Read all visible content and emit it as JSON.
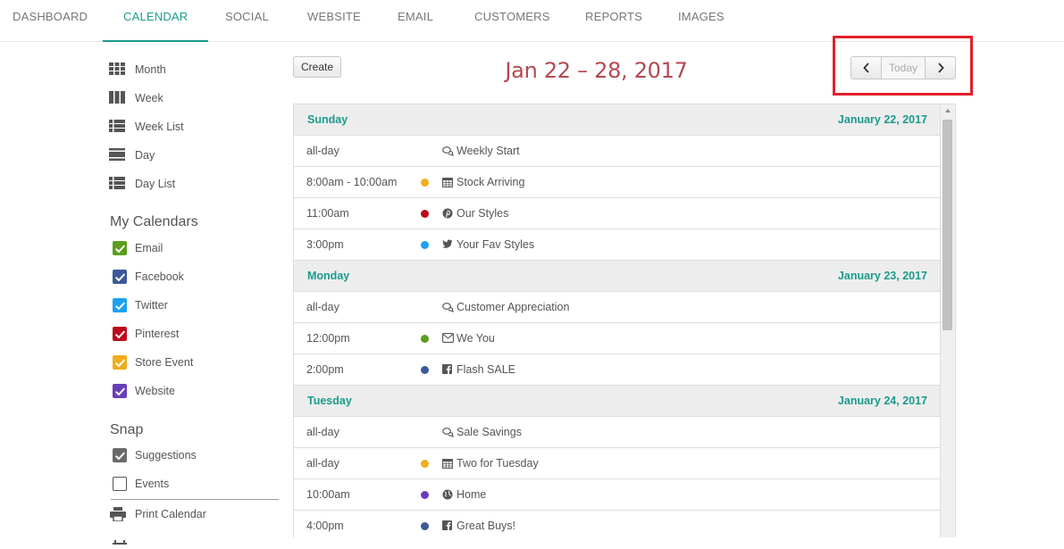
{
  "nav": {
    "tabs": [
      {
        "label": "DASHBOARD"
      },
      {
        "label": "CALENDAR"
      },
      {
        "label": "SOCIAL"
      },
      {
        "label": "WEBSITE"
      },
      {
        "label": "EMAIL"
      },
      {
        "label": "CUSTOMERS"
      },
      {
        "label": "REPORTS"
      },
      {
        "label": "IMAGES"
      }
    ],
    "active": "CALENDAR"
  },
  "sidebar": {
    "views": [
      {
        "label": "Month",
        "icon": "month-grid-icon"
      },
      {
        "label": "Week",
        "icon": "week-columns-icon"
      },
      {
        "label": "Week List",
        "icon": "week-list-icon"
      },
      {
        "label": "Day",
        "icon": "day-icon"
      },
      {
        "label": "Day List",
        "icon": "day-list-icon"
      }
    ],
    "my_calendars_title": "My Calendars",
    "calendars": [
      {
        "label": "Email",
        "color": "#5a9e1e",
        "checked": true
      },
      {
        "label": "Facebook",
        "color": "#3b5998",
        "checked": true
      },
      {
        "label": "Twitter",
        "color": "#1da1f2",
        "checked": true
      },
      {
        "label": "Pinterest",
        "color": "#bd081c",
        "checked": true
      },
      {
        "label": "Store Event",
        "color": "#f0ad1c",
        "checked": true
      },
      {
        "label": "Website",
        "color": "#6a3db8",
        "checked": true
      }
    ],
    "snap_title": "Snap",
    "snap": [
      {
        "label": "Suggestions",
        "checked": true,
        "color": "#6a6a6a"
      },
      {
        "label": "Events",
        "checked": false
      }
    ],
    "print_label": "Print Calendar"
  },
  "header": {
    "create_label": "Create",
    "range_title": "Jan 22 – 28, 2017",
    "today_label": "Today"
  },
  "agenda": [
    {
      "day": "Sunday",
      "date": "January 22, 2017",
      "events": [
        {
          "time": "all-day",
          "dot": null,
          "icon": "chat-icon",
          "title": "Weekly Start"
        },
        {
          "time": "8:00am - 10:00am",
          "dot": "#f0ad1c",
          "icon": "calendar-icon",
          "title": "Stock Arriving"
        },
        {
          "time": "11:00am",
          "dot": "#bd081c",
          "icon": "pinterest-icon",
          "title": "Our Styles"
        },
        {
          "time": "3:00pm",
          "dot": "#1da1f2",
          "icon": "twitter-icon",
          "title": "Your Fav Styles"
        }
      ]
    },
    {
      "day": "Monday",
      "date": "January 23, 2017",
      "events": [
        {
          "time": "all-day",
          "dot": null,
          "icon": "chat-icon",
          "title": "Customer Appreciation"
        },
        {
          "time": "12:00pm",
          "dot": "#5a9e1e",
          "icon": "envelope-icon",
          "title": "We  You"
        },
        {
          "time": "2:00pm",
          "dot": "#3b5998",
          "icon": "facebook-icon",
          "title": "Flash SALE"
        }
      ]
    },
    {
      "day": "Tuesday",
      "date": "January 24, 2017",
      "events": [
        {
          "time": "all-day",
          "dot": null,
          "icon": "chat-icon",
          "title": "Sale Savings"
        },
        {
          "time": "all-day",
          "dot": "#f0ad1c",
          "icon": "calendar-icon",
          "title": "Two for Tuesday"
        },
        {
          "time": "10:00am",
          "dot": "#6a3db8",
          "icon": "globe-icon",
          "title": "Home"
        },
        {
          "time": "4:00pm",
          "dot": "#3b5998",
          "icon": "facebook-icon",
          "title": "Great Buys!"
        }
      ]
    }
  ]
}
